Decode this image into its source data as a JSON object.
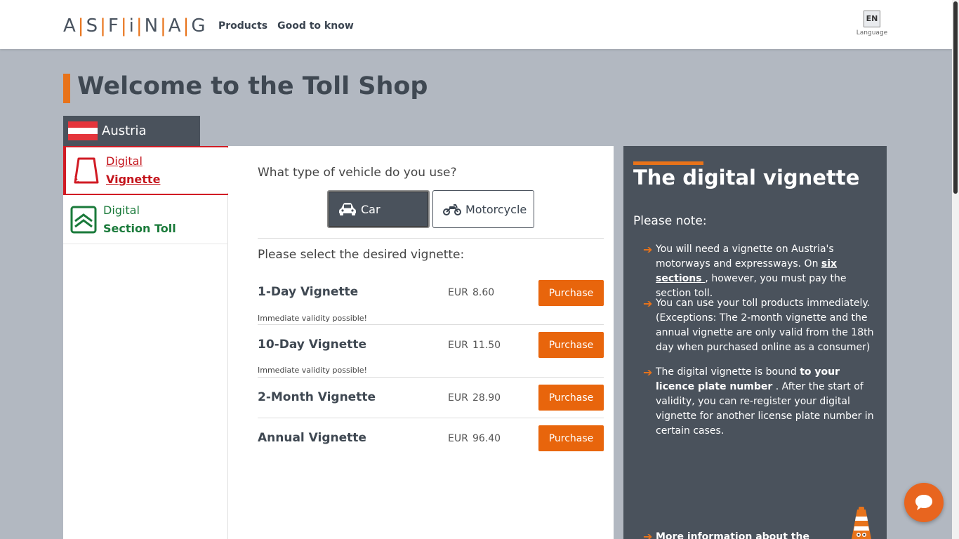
{
  "header": {
    "logo_letters": [
      "A",
      "S",
      "F",
      "i",
      "N",
      "A",
      "G"
    ],
    "nav": [
      "Products",
      "Good to know"
    ],
    "language_code": "EN",
    "language_label": "Language"
  },
  "page_title": "Welcome to the Toll Shop",
  "country_tab": "Austria",
  "product_nav": {
    "items": [
      {
        "line1": "Digital",
        "line2": "Vignette",
        "active": true
      },
      {
        "line1": "Digital",
        "line2": "Section Toll",
        "active": false
      }
    ]
  },
  "main": {
    "question": "What type of vehicle do you use?",
    "vehicle_options": [
      {
        "label": "Car",
        "selected": true
      },
      {
        "label": "Motorcycle",
        "selected": false
      }
    ],
    "select_prompt": "Please select the desired vignette:",
    "vignettes": [
      {
        "name": "1-Day Vignette",
        "currency": "EUR",
        "price": "8.60",
        "button": "Purchase",
        "note": "Immediate validity possible!"
      },
      {
        "name": "10-Day Vignette",
        "currency": "EUR",
        "price": "11.50",
        "button": "Purchase",
        "note": "Immediate validity possible!"
      },
      {
        "name": "2-Month Vignette",
        "currency": "EUR",
        "price": "28.90",
        "button": "Purchase",
        "note": ""
      },
      {
        "name": "Annual Vignette",
        "currency": "EUR",
        "price": "96.40",
        "button": "Purchase",
        "note": ""
      }
    ]
  },
  "info": {
    "title": "The digital vignette",
    "note_heading": "Please note:",
    "bullets": {
      "b1_a": "You will need a vignette on Austria's motorways and expressways. On ",
      "b1_link": "six sections ",
      "b1_b": ", however, you must pay the section toll.",
      "b2": "You can use your toll products immediately. (Exceptions: The 2-month vignette and the annual vignette are only valid from the 18th day when purchased online as a consumer)",
      "b3_a": "The digital vignette is bound ",
      "b3_bold": "to your licence plate number",
      "b3_b": " . After the start of validity, you can re-register your digital vignette for another license plate number in certain cases."
    },
    "more": "More information about the"
  },
  "colors": {
    "accent": "#e8731a",
    "purchase": "#e8650c",
    "active_red": "#d11b24",
    "section_green": "#1a7a3a",
    "dark_panel": "#4a525c",
    "background": "#b2b8c1"
  }
}
